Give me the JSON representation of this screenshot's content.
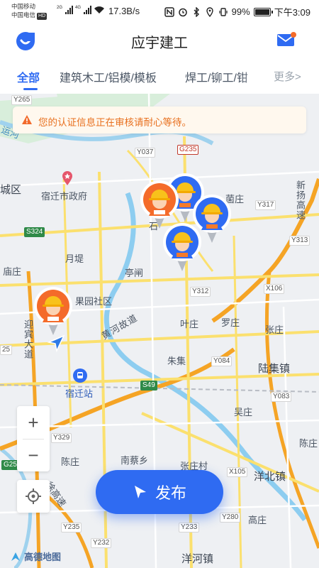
{
  "status_bar": {
    "carrier1": "中国移动",
    "carrier2": "中国电信",
    "hd": "HD",
    "net1": "2G",
    "net2": "4G",
    "speed": "17.3B/s",
    "battery": "99%",
    "time": "下午3:09"
  },
  "header": {
    "title": "应宇建工"
  },
  "tabs": [
    {
      "label": "全部"
    },
    {
      "label": "建筑木工/铝模/模板"
    },
    {
      "label": "焊工/铆工/钳"
    },
    {
      "label": "更多>"
    }
  ],
  "notice": {
    "text": "您的认证信息正在审核请耐心等待。"
  },
  "map": {
    "places": {
      "chengqu": "城区",
      "gov": "宿迁市政府",
      "yuedi": "月堤",
      "miaozhuang": "庙庄",
      "tingzha": "亭闸",
      "guoyuan": "果园社区",
      "yeshu": "叶庄",
      "luozhuang": "罗庄",
      "zhangzhuang": "张庄",
      "zhuji": "朱集",
      "lujizhen": "陆集镇",
      "wuzhuang": "吴庄",
      "chenzhuang_right": "陈庄",
      "chenzhuang_left": "陈庄",
      "nancaixiang": "南蔡乡",
      "zhangzhuangcun": "张庄村",
      "yangbeizhen": "洋北镇",
      "gaozhuang": "高庄",
      "yanghezhen": "洋河镇",
      "nanzhuang": "菌庄",
      "suqian_station": "宿迁站",
      "yingbin": "迎宾大道",
      "huanghe": "黄河故道",
      "xinyang": "新扬高速",
      "yunhe": "运河",
      "xiuxu": "徐高速",
      "shiqu": "石"
    },
    "roads": {
      "y265": "Y265",
      "y037": "Y037",
      "g235a": "G235",
      "y317": "Y317",
      "y313": "Y313",
      "s324": "S324",
      "y312": "Y312",
      "x106": "X106",
      "y084": "Y084",
      "s49": "S49",
      "y083": "Y083",
      "y329": "Y329",
      "g25": "G25",
      "x105": "X105",
      "y280": "Y280",
      "y235": "Y235",
      "y232": "Y232",
      "y233": "Y233",
      "g235b": "25"
    },
    "logo": "高德地图"
  },
  "controls": {
    "zoom_in": "+",
    "zoom_out": "−"
  },
  "publish": {
    "label": "发布"
  },
  "colors": {
    "primary": "#2f6bf2",
    "notice_text": "#e8701f",
    "worker_orange": "#f46b2a"
  }
}
